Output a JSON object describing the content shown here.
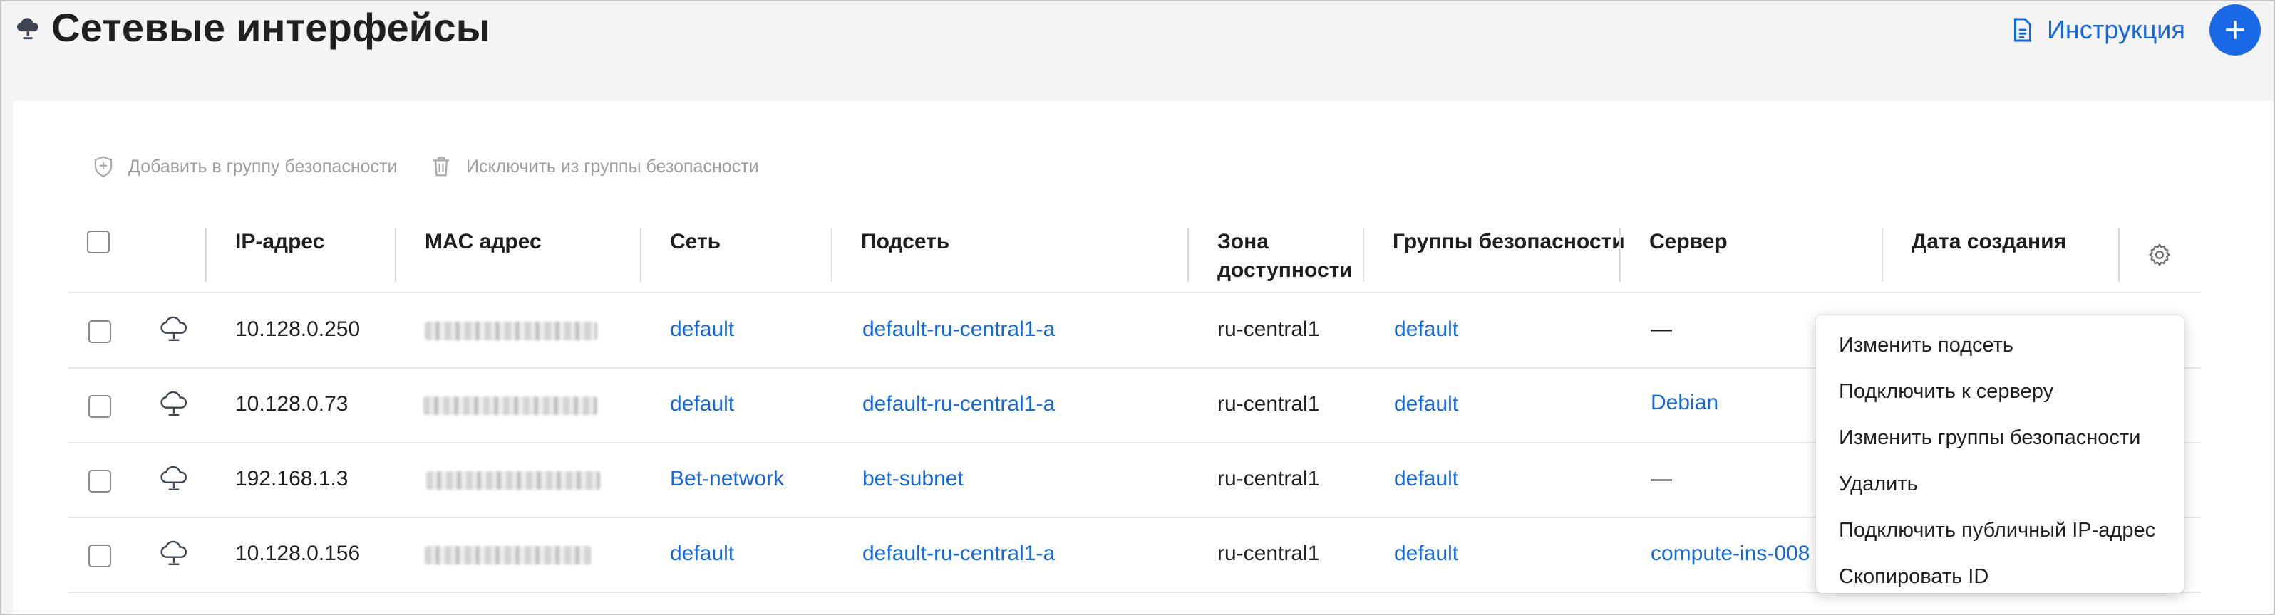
{
  "header": {
    "title": "Сетевые интерфейсы",
    "instructions_label": "Инструкция"
  },
  "toolbar": {
    "add_to_group": "Добавить в группу безопасности",
    "remove_from_group": "Исключить из группы безопасности"
  },
  "table": {
    "columns": {
      "ip": "IP-адрес",
      "mac": "MAC адрес",
      "network": "Сеть",
      "subnet": "Подсеть",
      "zone_line1": "Зона",
      "zone_line2": "доступности",
      "security_groups": "Группы безопасности",
      "server": "Сервер",
      "created": "Дата создания"
    },
    "rows": [
      {
        "ip": "10.128.0.250",
        "network": "default",
        "subnet": "default-ru-central1-a",
        "zone": "ru-central1",
        "security_group": "default",
        "server": "—"
      },
      {
        "ip": "10.128.0.73",
        "network": "default",
        "subnet": "default-ru-central1-a",
        "zone": "ru-central1",
        "security_group": "default",
        "server": "Debian"
      },
      {
        "ip": "192.168.1.3",
        "network": "Bet-network",
        "subnet": "bet-subnet",
        "zone": "ru-central1",
        "security_group": "default",
        "server": "—"
      },
      {
        "ip": "10.128.0.156",
        "network": "default",
        "subnet": "default-ru-central1-a",
        "zone": "ru-central1",
        "security_group": "default",
        "server": "compute-ins-008"
      }
    ]
  },
  "context_menu": {
    "items": [
      "Изменить подсеть",
      "Подключить к серверу",
      "Изменить группы безопасности",
      "Удалить",
      "Подключить публичный IP-адрес",
      "Скопировать ID"
    ]
  },
  "colors": {
    "accent": "#1467e2",
    "add_button": "#1a6ae8",
    "background": "#f4f4f4"
  },
  "icons": {
    "page": "cloud-network-icon",
    "instructions": "document-icon",
    "add": "plus-icon",
    "add_to_group": "shield-icon",
    "remove_from_group": "trash-icon",
    "row": "cloud-network-icon",
    "settings": "gear-icon"
  }
}
